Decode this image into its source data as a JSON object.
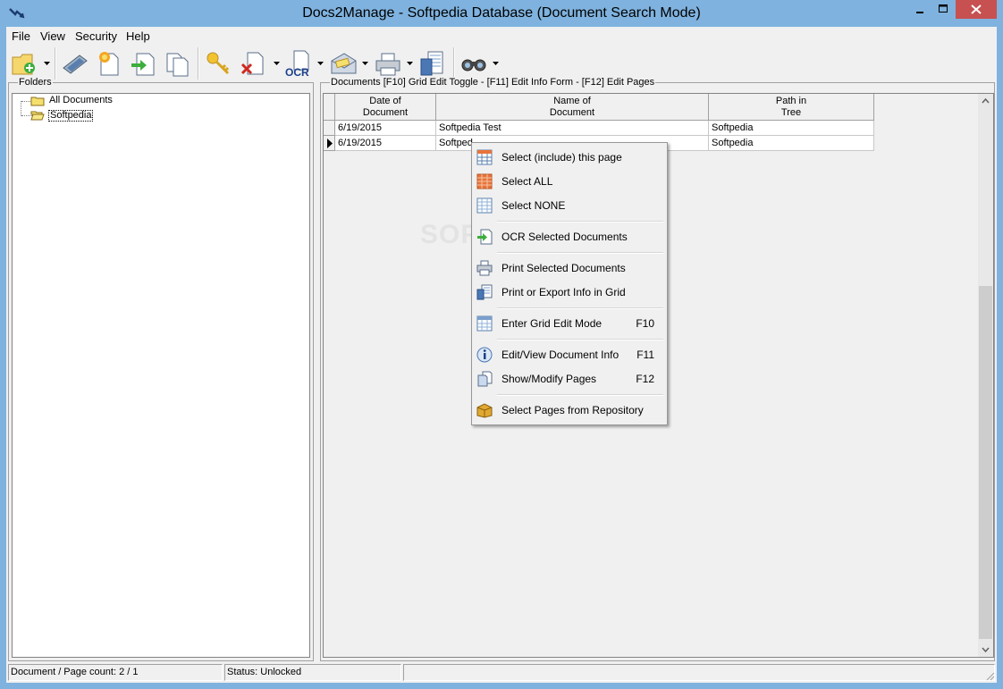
{
  "window": {
    "title": "Docs2Manage - Softpedia Database (Document Search Mode)",
    "controls": {
      "minimize": "minimize-icon",
      "maximize": "maximize-icon",
      "close": "close-icon"
    }
  },
  "menubar": {
    "items": [
      "File",
      "View",
      "Security",
      "Help"
    ]
  },
  "toolbar": {
    "buttons": [
      "new-folder-icon",
      "scanner-icon",
      "new-document-icon",
      "import-icon",
      "copy-pages-icon",
      "key-icon",
      "delete-document-icon",
      "ocr-icon",
      "email-icon",
      "printer-icon",
      "export-icon",
      "search-binoculars-icon"
    ],
    "ocr_label": "OCR"
  },
  "folders": {
    "label": "Folders",
    "items": [
      {
        "label": "All Documents",
        "selected": false
      },
      {
        "label": "Softpedia",
        "selected": true
      }
    ]
  },
  "documents": {
    "label": "Documents  [F10] Grid Edit Toggle - [F11] Edit Info Form - [F12] Edit Pages",
    "columns": [
      {
        "line1": "Date of",
        "line2": "Document"
      },
      {
        "line1": "Name of",
        "line2": "Document"
      },
      {
        "line1": "Path in",
        "line2": "Tree"
      }
    ],
    "rows": [
      {
        "date": "6/19/2015",
        "name": "Softpedia Test",
        "path": "Softpedia",
        "current": false
      },
      {
        "date": "6/19/2015",
        "name": "Softped",
        "path": "Softpedia",
        "current": true
      }
    ]
  },
  "context_menu": {
    "items": [
      {
        "label": "Select (include) this page",
        "shortcut": "",
        "icon": "grid-select-icon"
      },
      {
        "label": "Select ALL",
        "shortcut": "",
        "icon": "grid-select-all-icon"
      },
      {
        "label": "Select NONE",
        "shortcut": "",
        "icon": "grid-select-none-icon"
      },
      {
        "label": "OCR Selected Documents",
        "shortcut": "",
        "icon": "ocr-documents-icon"
      },
      {
        "label": "Print Selected Documents",
        "shortcut": "",
        "icon": "printer-icon"
      },
      {
        "label": "Print or Export Info in Grid",
        "shortcut": "",
        "icon": "export-grid-icon"
      },
      {
        "label": "Enter Grid Edit Mode",
        "shortcut": "F10",
        "icon": "grid-edit-icon"
      },
      {
        "label": "Edit/View Document Info",
        "shortcut": "F11",
        "icon": "info-icon"
      },
      {
        "label": "Show/Modify Pages",
        "shortcut": "F12",
        "icon": "pages-icon"
      },
      {
        "label": "Select Pages from Repository",
        "shortcut": "",
        "icon": "repository-box-icon"
      }
    ]
  },
  "statusbar": {
    "count": "Document / Page count: 2 / 1",
    "status": "Status: Unlocked",
    "extra": ""
  },
  "watermark": "SOFTPEDIA",
  "colors": {
    "titlebar": "#7fb2de",
    "close_button": "#c75050",
    "window_bg": "#f0f0f0",
    "grid_bg": "#ffffff"
  }
}
